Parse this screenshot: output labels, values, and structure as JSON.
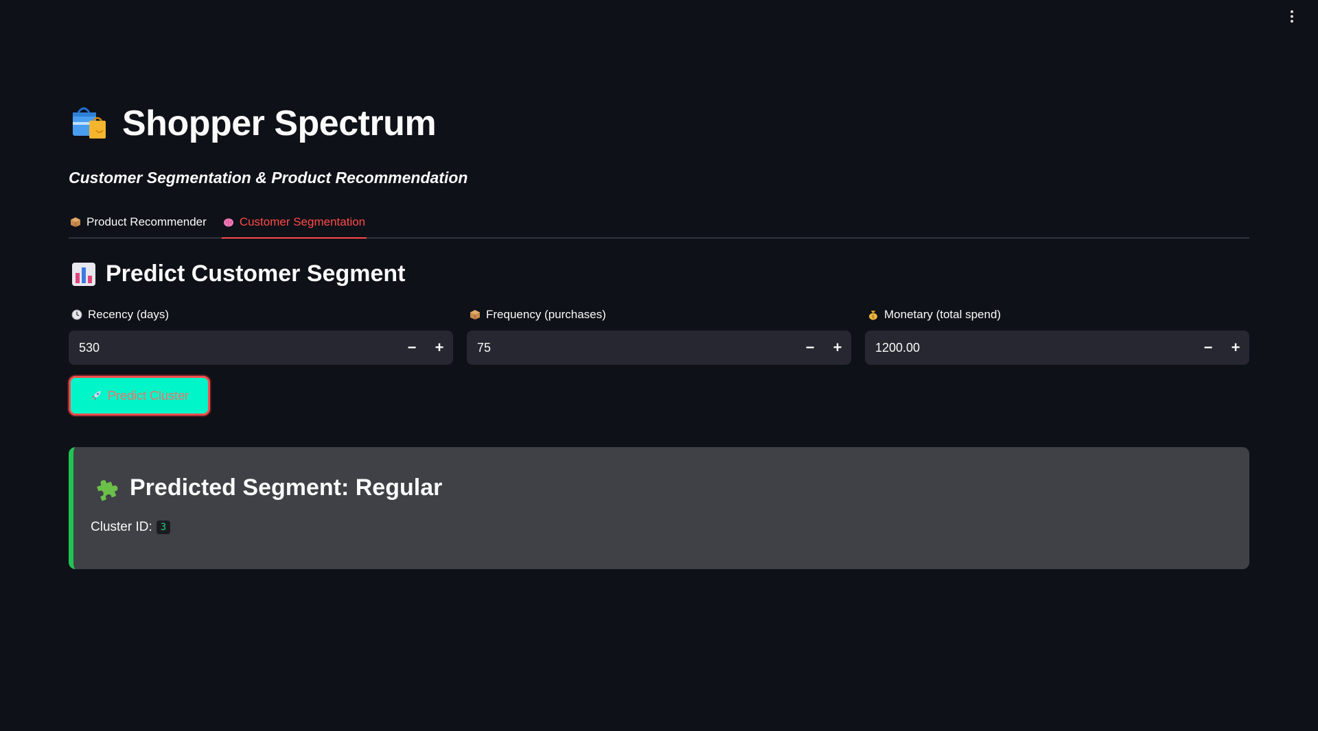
{
  "app": {
    "title": "Shopper Spectrum",
    "subtitle": "Customer Segmentation & Product Recommendation",
    "title_icon": "shopping-bags-icon"
  },
  "tabs": [
    {
      "label": "Product Recommender",
      "icon": "package-icon",
      "active": false
    },
    {
      "label": "Customer Segmentation",
      "icon": "brain-icon",
      "active": true
    }
  ],
  "section": {
    "title": "Predict Customer Segment",
    "icon": "bar-chart-icon"
  },
  "inputs": [
    {
      "label": "Recency (days)",
      "icon": "clock-icon",
      "value": "530"
    },
    {
      "label": "Frequency (purchases)",
      "icon": "package-icon",
      "value": "75"
    },
    {
      "label": "Monetary (total spend)",
      "icon": "money-bag-icon",
      "value": "1200.00"
    }
  ],
  "predict_button": {
    "label": "Predict Cluster",
    "icon": "rocket-icon"
  },
  "result": {
    "title": "Predicted Segment: Regular",
    "icon": "puzzle-icon",
    "cluster_label": "Cluster ID:",
    "cluster_id": "3"
  },
  "colors": {
    "background": "#0e1117",
    "accent": "#ff4b4b",
    "button_bg": "#00f5c8",
    "success_border": "#21c354",
    "input_bg": "#262730",
    "result_bg": "#3f4146"
  }
}
